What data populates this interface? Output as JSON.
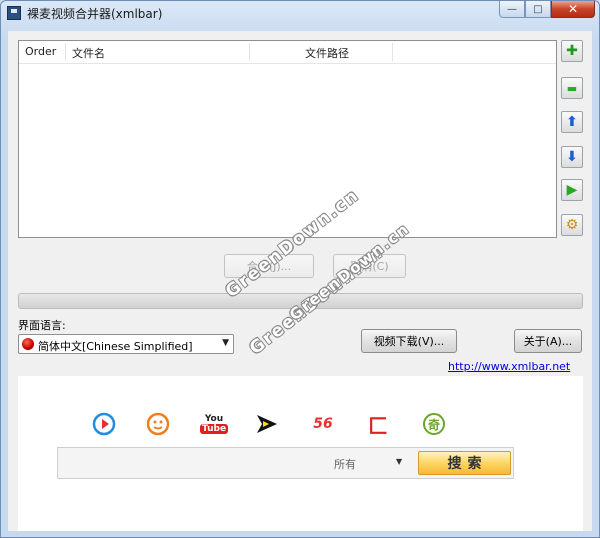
{
  "window": {
    "title": "裸麦视频合并器(xmlbar)",
    "minimize_glyph": "—",
    "maximize_glyph": "□",
    "close_glyph": "✕"
  },
  "file_list": {
    "columns": [
      "Order",
      "文件名",
      "文件路径"
    ],
    "rows": []
  },
  "side_buttons": [
    {
      "name": "add-icon",
      "glyph": "✚",
      "color": "#1e9b1e"
    },
    {
      "name": "remove-icon",
      "glyph": "▬",
      "color": "#2ea82e"
    },
    {
      "name": "move-up-icon",
      "glyph": "⬆",
      "color": "#1a5fd0"
    },
    {
      "name": "move-down-icon",
      "glyph": "⬇",
      "color": "#1a5fd0"
    },
    {
      "name": "play-icon",
      "glyph": "▶",
      "color": "#25a925"
    },
    {
      "name": "settings-icon",
      "glyph": "⚙",
      "color": "#c98f10"
    }
  ],
  "actions": {
    "merge_label": "合并(J)...",
    "cancel_label": "取消(C)"
  },
  "language": {
    "label": "界面语言:",
    "selected": "简体中文[Chinese Simplified]"
  },
  "buttons": {
    "video_download": "视频下载(V)...",
    "about": "关于(A)..."
  },
  "website": "http://www.xmlbar.net",
  "video_sites": [
    {
      "name": "youku-icon",
      "glyph": "▶",
      "color": "#1e8fe0"
    },
    {
      "name": "tudou-icon",
      "glyph": "☺",
      "color": "#f07d20"
    },
    {
      "name": "youtube-icon",
      "text_top": "You",
      "text_bottom": "Tube",
      "color": "#e02020"
    },
    {
      "name": "iqiyi-icon",
      "glyph": "▶",
      "color": "#111111"
    },
    {
      "name": "56-icon",
      "text": "56",
      "color": "#e83030"
    },
    {
      "name": "letv-icon",
      "text": "匚",
      "color": "#e02020"
    },
    {
      "name": "qiyi-icon",
      "text": "奇",
      "color": "#6aa52a"
    }
  ],
  "search": {
    "value": "",
    "scope": "所有",
    "button_label": "搜索"
  },
  "watermark": [
    "GreenDown.cn",
    "GreenDown.cn",
    "GreenDown.cn"
  ]
}
